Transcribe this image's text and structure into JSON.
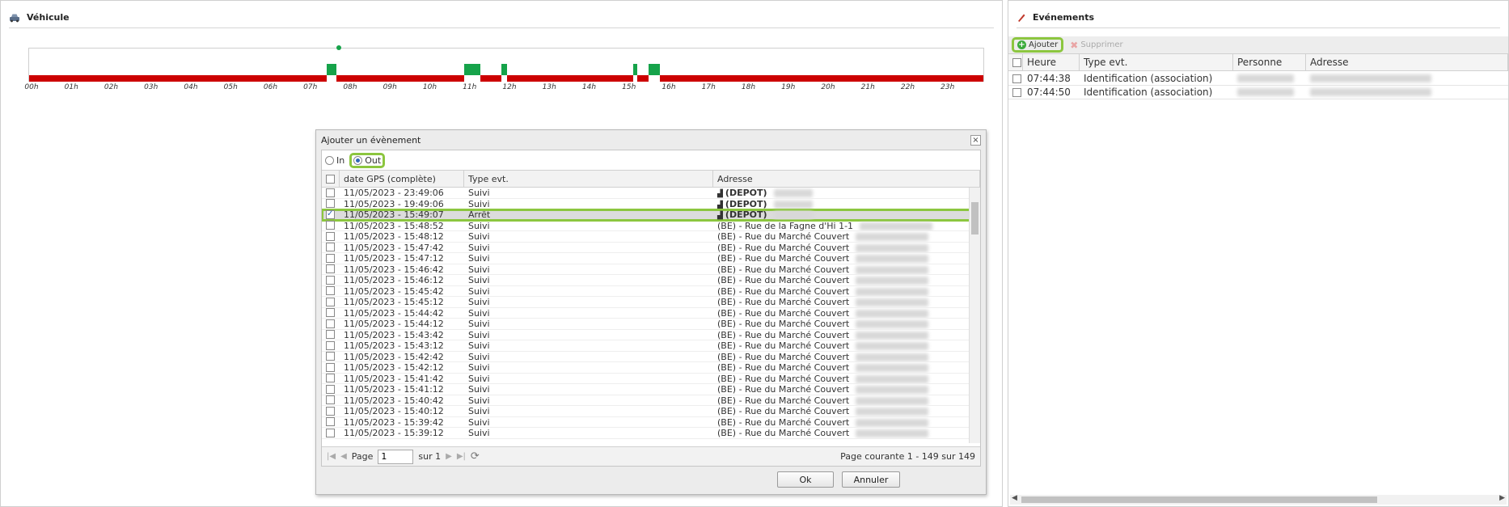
{
  "vehicle_panel": {
    "title": "Véhicule"
  },
  "timeline": {
    "hours": [
      "00h",
      "01h",
      "02h",
      "03h",
      "04h",
      "05h",
      "06h",
      "07h",
      "08h",
      "09h",
      "10h",
      "11h",
      "12h",
      "13h",
      "14h",
      "15h",
      "16h",
      "17h",
      "18h",
      "19h",
      "20h",
      "21h",
      "22h",
      "23h"
    ],
    "colors": {
      "off": "#cc0000",
      "on": "#16a34a"
    }
  },
  "dialog": {
    "title": "Ajouter un évènement",
    "radio_in": "In",
    "radio_out": "Out",
    "columns": [
      "date GPS (complète)",
      "Type evt.",
      "Adresse"
    ],
    "rows": [
      {
        "date": "11/05/2023 - 23:49:06",
        "type": "Suivi",
        "address": "(DEPOT)",
        "depot": true
      },
      {
        "date": "11/05/2023 - 19:49:06",
        "type": "Suivi",
        "address": "(DEPOT)",
        "depot": true
      },
      {
        "date": "11/05/2023 - 15:49:07",
        "type": "Arrêt",
        "address": "(DEPOT)",
        "depot": true,
        "selected": true
      },
      {
        "date": "11/05/2023 - 15:48:52",
        "type": "Suivi",
        "address": "(BE) - Rue de la Fagne d'Hi 1-1"
      },
      {
        "date": "11/05/2023 - 15:48:12",
        "type": "Suivi",
        "address": "(BE) - Rue du Marché Couvert"
      },
      {
        "date": "11/05/2023 - 15:47:42",
        "type": "Suivi",
        "address": "(BE) - Rue du Marché Couvert"
      },
      {
        "date": "11/05/2023 - 15:47:12",
        "type": "Suivi",
        "address": "(BE) - Rue du Marché Couvert"
      },
      {
        "date": "11/05/2023 - 15:46:42",
        "type": "Suivi",
        "address": "(BE) - Rue du Marché Couvert"
      },
      {
        "date": "11/05/2023 - 15:46:12",
        "type": "Suivi",
        "address": "(BE) - Rue du Marché Couvert"
      },
      {
        "date": "11/05/2023 - 15:45:42",
        "type": "Suivi",
        "address": "(BE) - Rue du Marché Couvert"
      },
      {
        "date": "11/05/2023 - 15:45:12",
        "type": "Suivi",
        "address": "(BE) - Rue du Marché Couvert"
      },
      {
        "date": "11/05/2023 - 15:44:42",
        "type": "Suivi",
        "address": "(BE) - Rue du Marché Couvert"
      },
      {
        "date": "11/05/2023 - 15:44:12",
        "type": "Suivi",
        "address": "(BE) - Rue du Marché Couvert"
      },
      {
        "date": "11/05/2023 - 15:43:42",
        "type": "Suivi",
        "address": "(BE) - Rue du Marché Couvert"
      },
      {
        "date": "11/05/2023 - 15:43:12",
        "type": "Suivi",
        "address": "(BE) - Rue du Marché Couvert"
      },
      {
        "date": "11/05/2023 - 15:42:42",
        "type": "Suivi",
        "address": "(BE) - Rue du Marché Couvert"
      },
      {
        "date": "11/05/2023 - 15:42:12",
        "type": "Suivi",
        "address": "(BE) - Rue du Marché Couvert"
      },
      {
        "date": "11/05/2023 - 15:41:42",
        "type": "Suivi",
        "address": "(BE) - Rue du Marché Couvert"
      },
      {
        "date": "11/05/2023 - 15:41:12",
        "type": "Suivi",
        "address": "(BE) - Rue du Marché Couvert"
      },
      {
        "date": "11/05/2023 - 15:40:42",
        "type": "Suivi",
        "address": "(BE) - Rue du Marché Couvert"
      },
      {
        "date": "11/05/2023 - 15:40:12",
        "type": "Suivi",
        "address": "(BE) - Rue du Marché Couvert"
      },
      {
        "date": "11/05/2023 - 15:39:42",
        "type": "Suivi",
        "address": "(BE) - Rue du Marché Couvert"
      },
      {
        "date": "11/05/2023 - 15:39:12",
        "type": "Suivi",
        "address": "(BE) - Rue du Marché Couvert"
      }
    ],
    "pager": {
      "page_label": "Page",
      "page_value": "1",
      "of_label": "sur 1",
      "summary": "Page courante 1 - 149 sur 149"
    },
    "ok": "Ok",
    "cancel": "Annuler"
  },
  "events_panel": {
    "title": "Evénements",
    "add": "Ajouter",
    "delete": "Supprimer",
    "columns": [
      "Heure",
      "Type evt.",
      "Personne",
      "Adresse"
    ],
    "rows": [
      {
        "time": "07:44:38",
        "type": "Identification (association)"
      },
      {
        "time": "07:44:50",
        "type": "Identification (association)"
      }
    ]
  }
}
